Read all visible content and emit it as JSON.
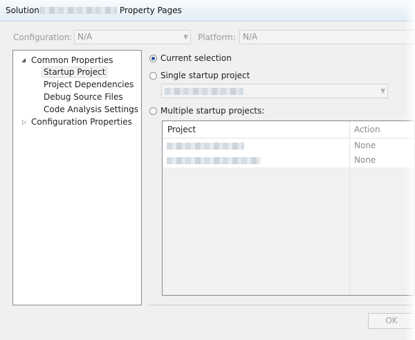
{
  "window": {
    "title_prefix": "Solution",
    "title_suffix": "Property Pages"
  },
  "top_bar": {
    "configuration_label": "Configuration:",
    "configuration_value": "N/A",
    "platform_label": "Platform:",
    "platform_value": "N/A"
  },
  "tree": {
    "common_properties": "Common Properties",
    "startup_project": "Startup Project",
    "project_dependencies": "Project Dependencies",
    "debug_source_files": "Debug Source Files",
    "code_analysis_settings": "Code Analysis Settings",
    "configuration_properties": "Configuration Properties"
  },
  "options": {
    "current_selection": "Current selection",
    "single_startup": "Single startup project",
    "multiple_startup": "Multiple startup projects:"
  },
  "grid": {
    "col_project": "Project",
    "col_action": "Action",
    "rows": [
      {
        "action": "None"
      },
      {
        "action": "None"
      }
    ]
  },
  "buttons": {
    "ok": "OK"
  }
}
